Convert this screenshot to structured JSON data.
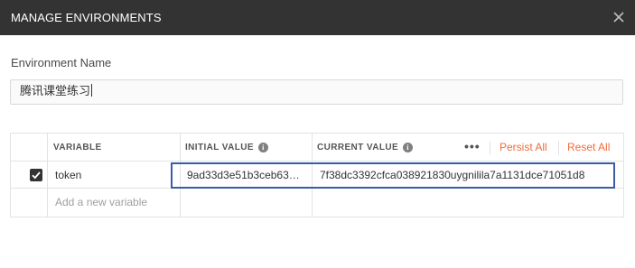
{
  "dialog": {
    "title": "MANAGE ENVIRONMENTS"
  },
  "environment": {
    "label": "Environment Name",
    "name_value": "腾讯课堂练习"
  },
  "table": {
    "headers": {
      "variable": "VARIABLE",
      "initial_value": "INITIAL VALUE",
      "current_value": "CURRENT VALUE",
      "more": "•••",
      "persist_all": "Persist All",
      "reset_all": "Reset All"
    },
    "rows": [
      {
        "checked": true,
        "variable": "token",
        "initial_value": "9ad33d3e51b3ceb63…",
        "current_value": "7f38dc3392cfca038921830uygnilila7a1131dce71051d8"
      }
    ],
    "new_variable_placeholder": "Add a new variable"
  },
  "colors": {
    "titlebar": "#333333",
    "accent_link": "#f26b3a",
    "highlight_border": "#3b5ba9"
  }
}
